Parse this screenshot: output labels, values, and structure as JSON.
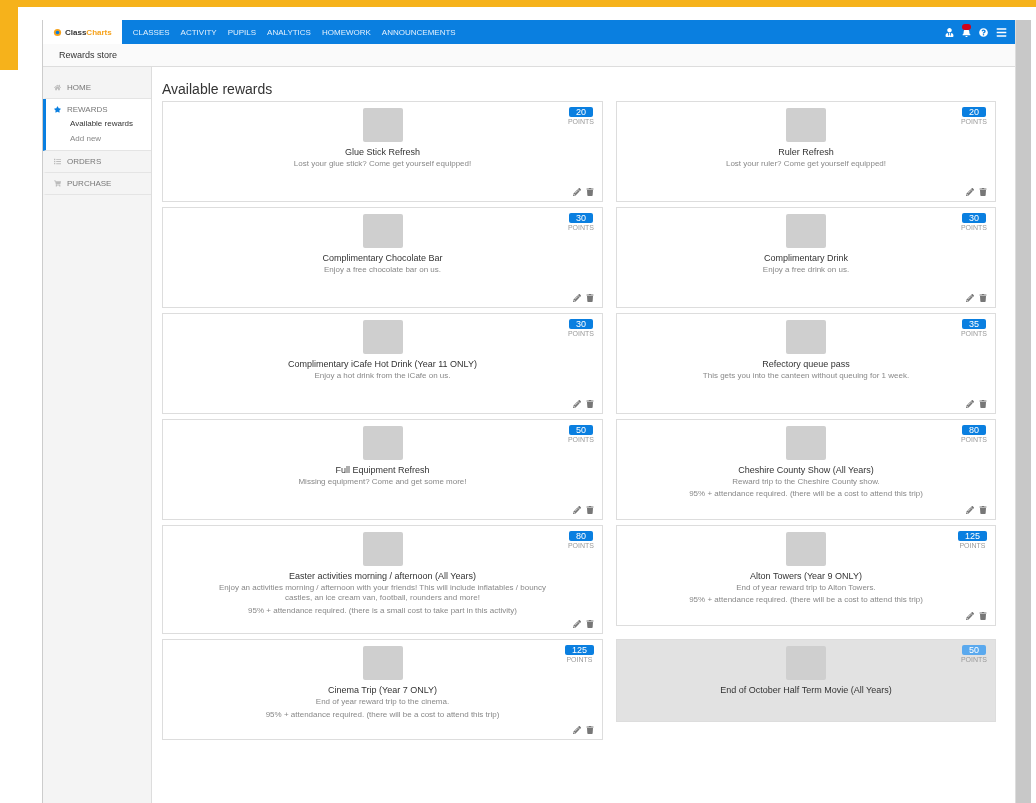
{
  "logo": {
    "part_1": "Class",
    "part_2": "Charts"
  },
  "nav": [
    "CLASSES",
    "ACTIVITY",
    "PUPILS",
    "ANALYTICS",
    "HOMEWORK",
    "ANNOUNCEMENTS"
  ],
  "breadcrumb": "Rewards store",
  "sidebar": {
    "items": [
      {
        "label": "HOME",
        "selected": false
      },
      {
        "label": "REWARDS",
        "selected": true,
        "children": [
          {
            "label": "Available rewards",
            "selected": true
          },
          {
            "label": "Add new",
            "selected": false
          }
        ]
      },
      {
        "label": "ORDERS",
        "selected": false
      },
      {
        "label": "PURCHASE",
        "selected": false
      }
    ]
  },
  "heading": "Available rewards",
  "rewards": [
    {
      "title": "Glue Stick Refresh",
      "points": "20",
      "points_label": "POINTS",
      "description": [
        "Lost your glue stick? Come get yourself equipped!"
      ],
      "disabled": false
    },
    {
      "title": "Ruler Refresh",
      "points": "20",
      "points_label": "POINTS",
      "description": [
        "Lost your ruler? Come get yourself equipped!"
      ],
      "disabled": false
    },
    {
      "title": "Complimentary Chocolate Bar",
      "points": "30",
      "points_label": "POINTS",
      "description": [
        "Enjoy a free chocolate bar on us."
      ],
      "disabled": false
    },
    {
      "title": "Complimentary Drink",
      "points": "30",
      "points_label": "POINTS",
      "description": [
        "Enjoy a free drink on us."
      ],
      "disabled": false
    },
    {
      "title": "Complimentary iCafe Hot Drink (Year 11 ONLY)",
      "points": "30",
      "points_label": "POINTS",
      "description": [
        "Enjoy a hot drink from the iCafe on us."
      ],
      "disabled": false
    },
    {
      "title": "Refectory queue pass",
      "points": "35",
      "points_label": "POINTS",
      "description": [
        "This gets you into the canteen without queuing for 1 week."
      ],
      "disabled": false
    },
    {
      "title": "Full Equipment Refresh",
      "points": "50",
      "points_label": "POINTS",
      "description": [
        "Missing equipment? Come and get some more!"
      ],
      "disabled": false
    },
    {
      "title": "Cheshire County Show (All Years)",
      "points": "80",
      "points_label": "POINTS",
      "description": [
        "Reward trip to the Cheshire County show.",
        "95% + attendance required. (there will be a cost to attend this trip)"
      ],
      "disabled": false
    },
    {
      "title": "Easter activities morning / afternoon (All Years)",
      "points": "80",
      "points_label": "POINTS",
      "description": [
        "Enjoy an activities morning / afternoon with your friends! This will include inflatables / bouncy castles, an ice cream van, football, rounders and more!",
        "95% + attendance required. (there is a small cost to take part in this activity)"
      ],
      "disabled": false
    },
    {
      "title": "Alton Towers (Year 9 ONLY)",
      "points": "125",
      "points_label": "POINTS",
      "description": [
        "End of year reward trip to Alton Towers.",
        "95% + attendance required. (there will be a cost to attend this trip)"
      ],
      "disabled": false
    },
    {
      "title": "Cinema Trip (Year 7 ONLY)",
      "points": "125",
      "points_label": "POINTS",
      "description": [
        "End of year reward trip to the cinema.",
        "95% + attendance required. (there will be a cost to attend this trip)"
      ],
      "disabled": false
    },
    {
      "title": "End of October Half Term Movie (All Years)",
      "points": "50",
      "points_label": "POINTS",
      "disabled": true
    }
  ]
}
